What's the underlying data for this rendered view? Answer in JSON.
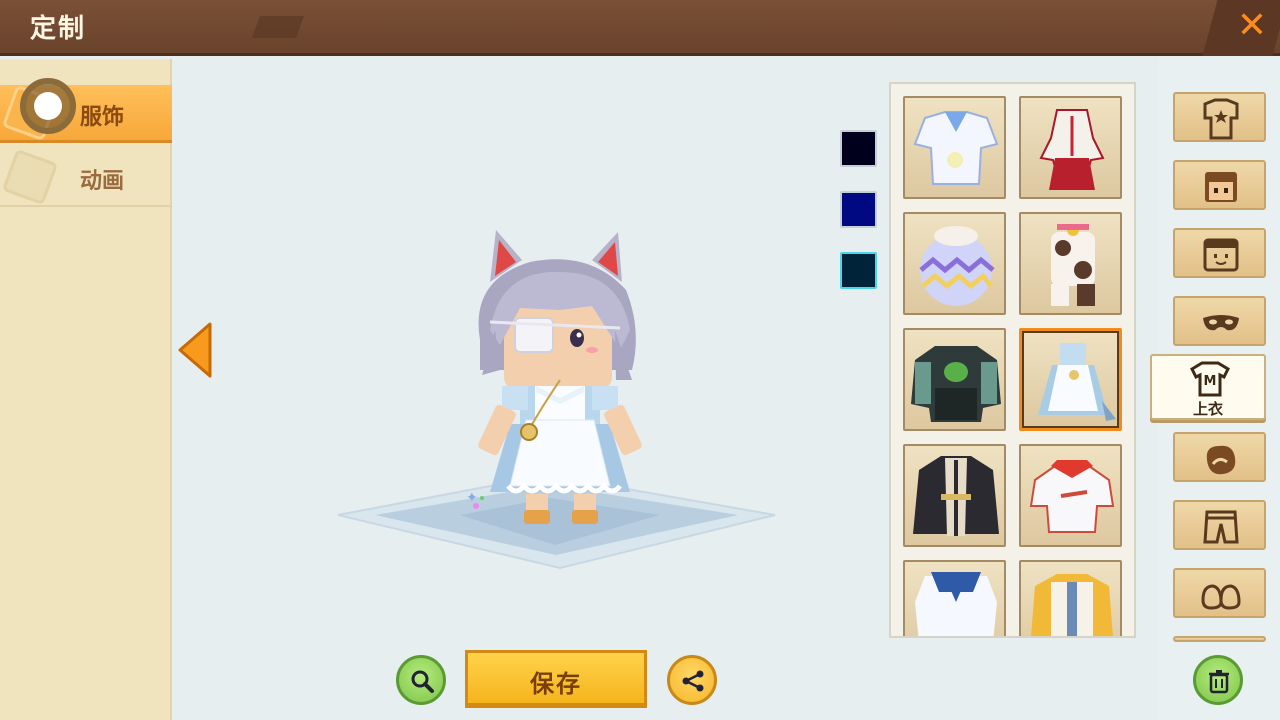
{
  "header": {
    "title": "定制",
    "close_icon": "close-icon"
  },
  "sidebar": {
    "tabs": [
      {
        "label": "服饰",
        "active": true
      },
      {
        "label": "动画",
        "active": false
      }
    ]
  },
  "colors": {
    "swatches": [
      "#00001c",
      "#000882",
      "#00233a"
    ],
    "accent": "#f7a83a",
    "selected_border": "#f08c1e"
  },
  "items": [
    {
      "name": "sailor-shirt",
      "selected": false
    },
    {
      "name": "red-white-dress",
      "selected": false
    },
    {
      "name": "easter-egg-outfit",
      "selected": false
    },
    {
      "name": "cow-costume",
      "selected": false
    },
    {
      "name": "seaweed-jacket",
      "selected": false
    },
    {
      "name": "blue-maid-dress",
      "selected": true
    },
    {
      "name": "dark-robe",
      "selected": false
    },
    {
      "name": "sport-shirt",
      "selected": false
    },
    {
      "name": "sailor-dress",
      "selected": false
    },
    {
      "name": "yellow-jacket",
      "selected": false
    }
  ],
  "categories": [
    {
      "icon": "suit-icon"
    },
    {
      "icon": "face-icon"
    },
    {
      "icon": "hat-face-icon"
    },
    {
      "icon": "mask-icon"
    },
    {
      "icon": "shirt-icon",
      "label": "上衣",
      "active": true
    },
    {
      "icon": "glove-icon"
    },
    {
      "icon": "pants-icon"
    },
    {
      "icon": "shoes-icon"
    }
  ],
  "bottom": {
    "save_label": "保存",
    "search_icon": "magnifier-icon",
    "share_icon": "share-icon",
    "trash_icon": "trash-icon"
  }
}
